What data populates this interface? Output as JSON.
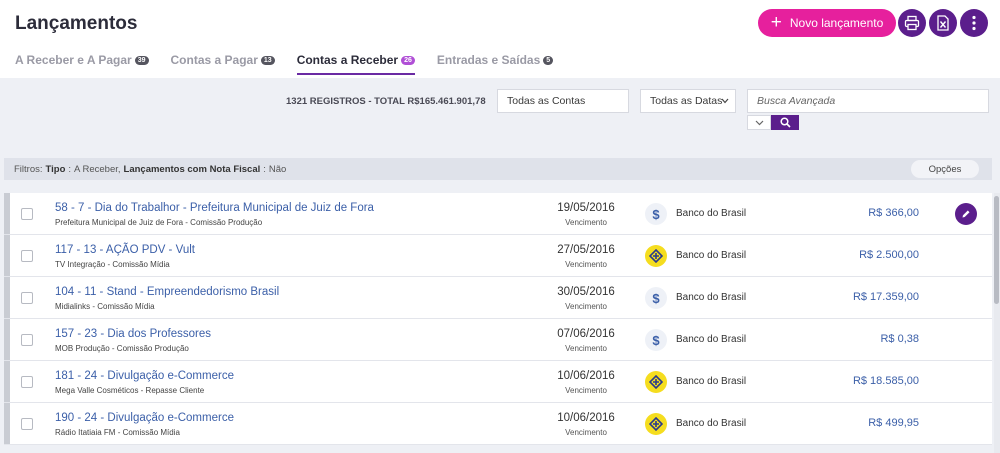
{
  "header": {
    "title": "Lançamentos",
    "new_button_label": "Novo lançamento",
    "print_icon": "printer-icon",
    "excel_icon": "excel-export-icon",
    "more_icon": "kebab-menu-icon"
  },
  "tabs": [
    {
      "label": "A Receber e A Pagar",
      "count": "39",
      "active": false
    },
    {
      "label": "Contas a Pagar",
      "count": "13",
      "active": false
    },
    {
      "label": "Contas a Receber",
      "count": "26",
      "active": true
    },
    {
      "label": "Entradas e Saídas",
      "count": "5",
      "active": false
    }
  ],
  "toolbar": {
    "summary": "1321 REGISTROS - TOTAL R$165.461.901,78",
    "accounts_select": "Todas as Contas",
    "dates_select": "Todas as Datas",
    "search_placeholder": "Busca Avançada"
  },
  "filters": {
    "prefix": "Filtros:",
    "type_label": "Tipo",
    "type_value": "A Receber,",
    "invoice_label": "Lançamentos com Nota Fiscal",
    "invoice_value": "Não",
    "options_label": "Opções"
  },
  "rows": [
    {
      "title": "58 - 7 - Dia do Trabalhor - Prefeitura Municipal de Juiz de Fora",
      "subtitle": "Prefeitura Municipal de Juiz de Fora - Comissão Produção",
      "date": "19/05/2016",
      "date_label": "Vencimento",
      "bank_icon": "dollar",
      "bank": "Banco do Brasil",
      "amount": "R$ 366,00",
      "editable": true
    },
    {
      "title": "117 - 13 - AÇÃO PDV - Vult",
      "subtitle": "TV Integração - Comissão Mídia",
      "date": "27/05/2016",
      "date_label": "Vencimento",
      "bank_icon": "bb",
      "bank": "Banco do Brasil",
      "amount": "R$ 2.500,00",
      "editable": false
    },
    {
      "title": "104 - 11 - Stand - Empreendedorismo Brasil",
      "subtitle": "Midialinks - Comissão Mídia",
      "date": "30/05/2016",
      "date_label": "Vencimento",
      "bank_icon": "dollar",
      "bank": "Banco do Brasil",
      "amount": "R$ 17.359,00",
      "editable": false
    },
    {
      "title": "157 - 23 - Dia dos Professores",
      "subtitle": "MOB Produção - Comissão Produção",
      "date": "07/06/2016",
      "date_label": "Vencimento",
      "bank_icon": "dollar",
      "bank": "Banco do Brasil",
      "amount": "R$ 0,38",
      "editable": false
    },
    {
      "title": "181 - 24 - Divulgação e-Commerce",
      "subtitle": "Mega Valle Cosméticos - Repasse Cliente",
      "date": "10/06/2016",
      "date_label": "Vencimento",
      "bank_icon": "bb",
      "bank": "Banco do Brasil",
      "amount": "R$ 18.585,00",
      "editable": false
    },
    {
      "title": "190 - 24 - Divulgação e-Commerce",
      "subtitle": "Rádio Itatiaia FM - Comissão Mídia",
      "date": "10/06/2016",
      "date_label": "Vencimento",
      "bank_icon": "bb",
      "bank": "Banco do Brasil",
      "amount": "R$ 499,95",
      "editable": false
    }
  ]
}
